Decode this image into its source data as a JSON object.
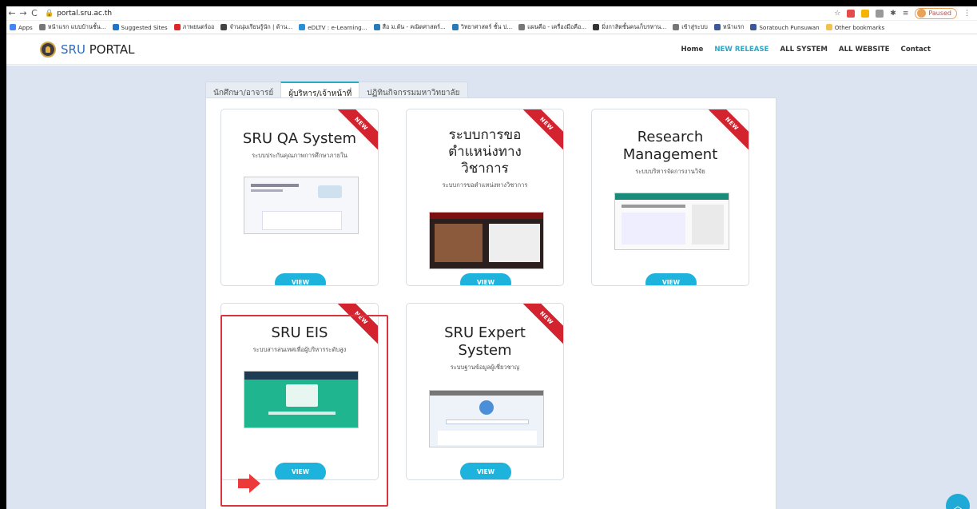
{
  "browser": {
    "url": "portal.sru.ac.th",
    "paused_label": "Paused",
    "bookmarks": [
      "Apps",
      "หน้าแรก แบบบ้านชั้น...",
      "Suggested Sites",
      "ภาพยนตร์ออ",
      "จำนนุ่มเรียนรู้นัก | ด้าน...",
      "eDLTV : e-Learning...",
      "สือ ม.ต้น - คณิตศาสตร์...",
      "วิทยาศาสตร์ ชั้น ป...",
      "แผนคือ - เครื่องมือคือ...",
      "มิ่งกาสิตชั้นคนเก็บรหาน...",
      "เข้าสู่ระบบ",
      "หน้าแรก",
      "Soratouch Punsuwan",
      "Other bookmarks"
    ]
  },
  "site": {
    "logo_sru": "SRU",
    "logo_portal": " PORTAL",
    "nav": [
      "Home",
      "NEW RELEASE",
      "ALL SYSTEM",
      "ALL WEBSITE",
      "Contact"
    ]
  },
  "tabs": [
    "นักศึกษา/อาจารย์",
    "ผู้บริหาร/เจ้าหน้าที่",
    "ปฏิทินกิจกรรมมหาวิทยาลัย"
  ],
  "ribbon_label": "NEW",
  "view_label": "VIEW",
  "cards": [
    {
      "title": "SRU QA System",
      "subtitle": "ระบบประกันคุณภาพการศึกษาภายใน"
    },
    {
      "title": "ระบบการขอ ตำแหน่งทาง วิชาการ",
      "subtitle": "ระบบการขอตำแหน่งทางวิชาการ"
    },
    {
      "title": "Research Management",
      "subtitle": "ระบบบริหารจัดการงานวิจัย"
    },
    {
      "title": "SRU EIS",
      "subtitle": "ระบบสารสนเทศเพื่อผู้บริหารระดับสูง"
    },
    {
      "title": "SRU Expert System",
      "subtitle": "ระบบฐานข้อมูลผู้เชี่ยวชาญ"
    }
  ],
  "colors": {
    "accent": "#1db3dc",
    "ribbon": "#d2232f",
    "highlight": "#d9353c"
  }
}
